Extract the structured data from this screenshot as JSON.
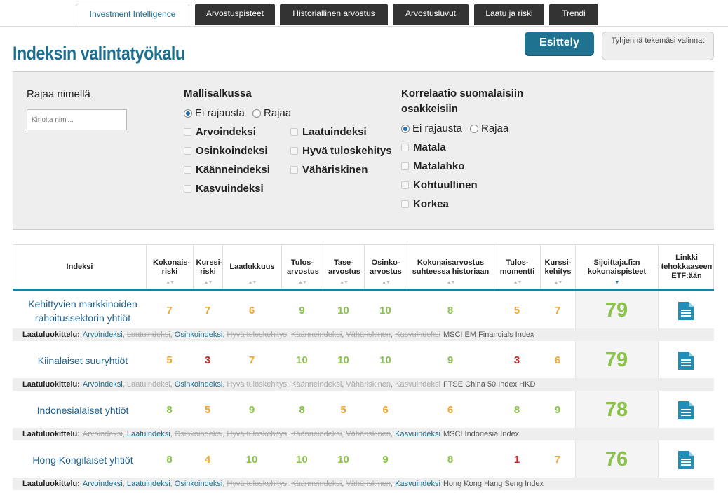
{
  "tabs": [
    "Investment Intelligence",
    "Arvostuspisteet",
    "Historiallinen arvostus",
    "Arvostusluvut",
    "Laatu ja riski",
    "Trendi"
  ],
  "page_title": "Indeksin valintatyökalu",
  "buttons": {
    "esittely": "Esittely",
    "clear": "Tyhjennä tekemäsi valinnat"
  },
  "filter": {
    "name_label": "Rajaa nimellä",
    "name_placeholder": "Kirjoita nimi...",
    "model_label": "Mallisalkussa",
    "model_radio": [
      "Ei rajausta",
      "Rajaa"
    ],
    "model_checks": [
      "Arvoindeksi",
      "Laatuindeksi",
      "Osinkoindeksi",
      "Hyvä tuloskehitys",
      "Käänneindeksi",
      "Vähäriskinen",
      "Kasvuindeksi"
    ],
    "corr_label": "Korrelaatio suomalaisiin osakkeisiin",
    "corr_radio": [
      "Ei rajausta",
      "Rajaa"
    ],
    "corr_checks": [
      "Matala",
      "Matalahko",
      "Kohtuullinen",
      "Korkea"
    ]
  },
  "columns": [
    "Indeksi",
    "Kokonais-riski",
    "Kurssi-riski",
    "Laadukkuus",
    "Tulos-arvostus",
    "Tase-arvostus",
    "Osinko-arvostus",
    "Kokonaisarvostus suhteessa historiaan",
    "Tulos-momentti",
    "Kurssi-kehitys",
    "Sijoittaja.fi:n kokonaispisteet",
    "Linkki tehokkaaseen ETF:ään"
  ],
  "quality_label": "Laatuluokittelu:",
  "rows": [
    {
      "name": "Kehittyvien markkinoiden rahoitussektorin yhtiöt",
      "values": [
        "7",
        "7",
        "6",
        "9",
        "10",
        "10",
        "8",
        "5",
        "7"
      ],
      "colors": [
        "o",
        "o",
        "o",
        "g",
        "g",
        "g",
        "g",
        "o",
        "o"
      ],
      "score": "79",
      "tags": [
        [
          "Arvoindeksi",
          1
        ],
        [
          "Laatuindeksi",
          0
        ],
        [
          "Osinkoindeksi",
          1
        ],
        [
          "Hyvä tuloskehitys",
          0
        ],
        [
          "Käänneindeksi",
          0
        ],
        [
          "Vähäriskinen",
          0
        ],
        [
          "Kasvuindeksi",
          0
        ]
      ],
      "source": "MSCI EM Financials Index"
    },
    {
      "name": "Kiinalaiset suuryhtiöt",
      "values": [
        "5",
        "3",
        "7",
        "10",
        "10",
        "10",
        "9",
        "3",
        "6"
      ],
      "colors": [
        "o",
        "r",
        "o",
        "g",
        "g",
        "g",
        "g",
        "r",
        "o"
      ],
      "score": "79",
      "tags": [
        [
          "Arvoindeksi",
          1
        ],
        [
          "Laatuindeksi",
          0
        ],
        [
          "Osinkoindeksi",
          1
        ],
        [
          "Hyvä tuloskehitys",
          0
        ],
        [
          "Käänneindeksi",
          0
        ],
        [
          "Vähäriskinen",
          0
        ],
        [
          "Kasvuindeksi",
          0
        ]
      ],
      "source": "FTSE China 50 Index HKD"
    },
    {
      "name": "Indonesialaiset yhtiöt",
      "values": [
        "8",
        "5",
        "9",
        "8",
        "5",
        "6",
        "6",
        "8",
        "9"
      ],
      "colors": [
        "g",
        "o",
        "g",
        "g",
        "o",
        "o",
        "o",
        "g",
        "g"
      ],
      "score": "78",
      "tags": [
        [
          "Arvoindeksi",
          0
        ],
        [
          "Laatuindeksi",
          1
        ],
        [
          "Osinkoindeksi",
          0
        ],
        [
          "Hyvä tuloskehitys",
          0
        ],
        [
          "Käänneindeksi",
          0
        ],
        [
          "Vähäriskinen",
          0
        ],
        [
          "Kasvuindeksi",
          1
        ]
      ],
      "source": "MSCI Indonesia Index"
    },
    {
      "name": "Hong Kongilaiset yhtiöt",
      "values": [
        "8",
        "4",
        "10",
        "10",
        "10",
        "9",
        "8",
        "1",
        "7"
      ],
      "colors": [
        "g",
        "o",
        "g",
        "g",
        "g",
        "g",
        "g",
        "r",
        "o"
      ],
      "score": "76",
      "tags": [
        [
          "Arvoindeksi",
          1
        ],
        [
          "Laatuindeksi",
          1
        ],
        [
          "Osinkoindeksi",
          1
        ],
        [
          "Hyvä tuloskehitys",
          0
        ],
        [
          "Käänneindeksi",
          0
        ],
        [
          "Vähäriskinen",
          0
        ],
        [
          "Kasvuindeksi",
          1
        ]
      ],
      "source": "Hong Kong Hang Seng Index"
    }
  ],
  "colors": {
    "accent": "#1d6f8e",
    "good": "#8bc34a",
    "medium": "#f0a830",
    "bad": "#c62828"
  }
}
